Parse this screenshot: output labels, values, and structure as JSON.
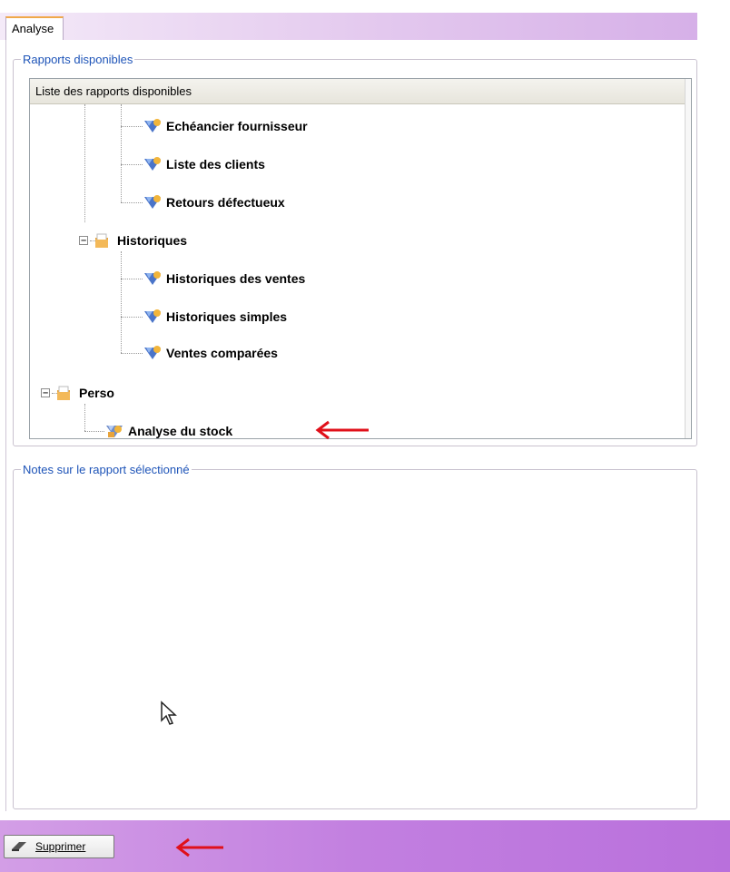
{
  "tab": {
    "label": "Analyse"
  },
  "reports_group": {
    "legend": "Rapports disponibles",
    "list_header": "Liste des rapports disponibles",
    "items": [
      {
        "label": "Echéancier fournisseur",
        "type": "report"
      },
      {
        "label": "Liste des clients",
        "type": "report"
      },
      {
        "label": "Retours défectueux",
        "type": "report"
      },
      {
        "label": "Historiques",
        "type": "folder",
        "expanded": true
      },
      {
        "label": "Historiques des ventes",
        "type": "report"
      },
      {
        "label": "Historiques simples",
        "type": "report"
      },
      {
        "label": "Ventes comparées",
        "type": "report"
      },
      {
        "label": "Perso",
        "type": "folder",
        "expanded": true
      },
      {
        "label": "Analyse du stock",
        "type": "report"
      }
    ]
  },
  "notes_group": {
    "legend": "Notes sur le rapport sélectionné"
  },
  "footer": {
    "delete_label": "Supprimer"
  },
  "colors": {
    "legend": "#1e54b8",
    "arrow": "#e0101a",
    "bottom_bar": "#c27fe0"
  }
}
